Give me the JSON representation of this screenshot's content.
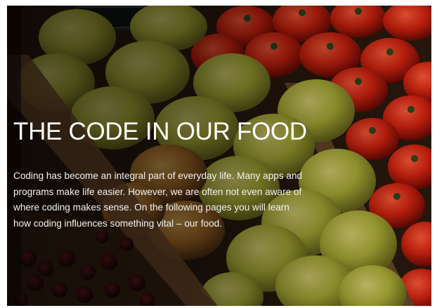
{
  "hero": {
    "title": "THE CODE IN OUR FOOD",
    "body": "Coding has become an integral part of everyday life. Many apps and programs make life easier. However, we are often not even aware of where coding makes sense. On the following pages you will learn how coding influences something vital – our food.",
    "image": "fruit-market-stall-photo"
  },
  "colors": {
    "title_text": "#ffffff",
    "body_text": "#f2f2f2"
  }
}
